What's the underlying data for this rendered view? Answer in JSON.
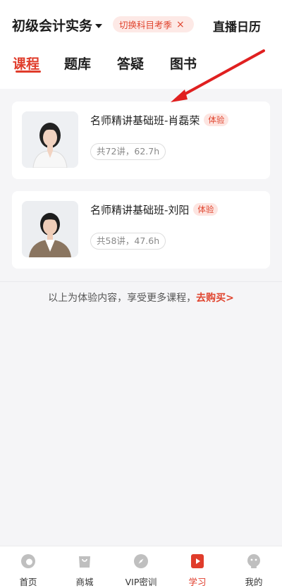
{
  "header": {
    "subject": "初级会计实务",
    "switch_label": "切换科目考季",
    "switch_close": "×",
    "calendar": "直播日历"
  },
  "tabs": [
    {
      "label": "课程",
      "active": true
    },
    {
      "label": "题库"
    },
    {
      "label": "答疑"
    },
    {
      "label": "图书"
    }
  ],
  "courses": [
    {
      "title": "名师精讲基础班-肖磊荣",
      "tag": "体验",
      "meta": "共72讲，62.7h"
    },
    {
      "title": "名师精讲基础班-刘阳",
      "tag": "体验",
      "meta": "共58讲，47.6h"
    }
  ],
  "footer": {
    "note": "以上为体验内容，享受更多课程，",
    "buy": "去购买>"
  },
  "nav": [
    {
      "label": "首页",
      "icon": "home-icon"
    },
    {
      "label": "商城",
      "icon": "shopping-bag-icon"
    },
    {
      "label": "VIP密训",
      "icon": "compass-icon"
    },
    {
      "label": "学习",
      "icon": "play-icon",
      "active": true
    },
    {
      "label": "我的",
      "icon": "profile-icon"
    }
  ],
  "colors": {
    "accent": "#e03c2b",
    "background": "#f5f5f7"
  }
}
